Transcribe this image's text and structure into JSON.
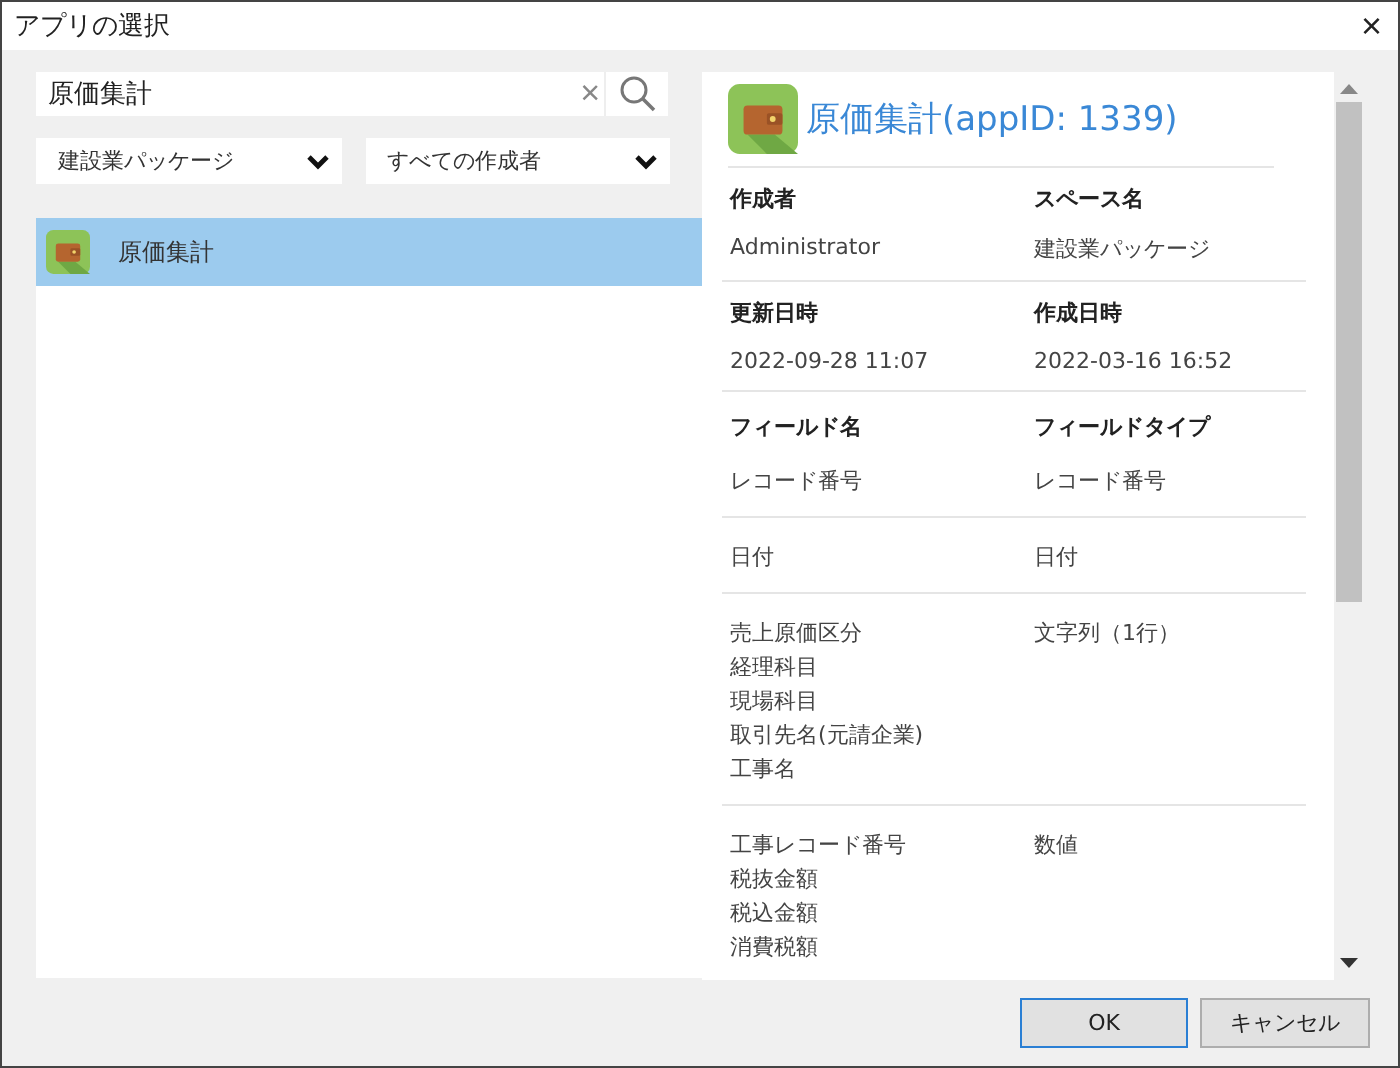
{
  "window": {
    "title": "アプリの選択",
    "close": "×"
  },
  "search": {
    "value": "原価集計",
    "clear": "×"
  },
  "filters": [
    {
      "value": "建設業パッケージ"
    },
    {
      "value": "すべての作成者"
    }
  ],
  "app_list": [
    {
      "name": "原価集計",
      "selected": true
    }
  ],
  "detail": {
    "title": "原価集計(appID: 1339)",
    "meta": [
      [
        {
          "label": "作成者",
          "value": "Administrator"
        },
        {
          "label": "スペース名",
          "value": "建設業パッケージ"
        }
      ],
      [
        {
          "label": "更新日時",
          "value": "2022-09-28 11:07"
        },
        {
          "label": "作成日時",
          "value": "2022-03-16 16:52"
        }
      ]
    ],
    "field_headers": [
      "フィールド名",
      "フィールドタイプ"
    ],
    "field_groups": [
      {
        "names": [
          "レコード番号"
        ],
        "type": "レコード番号"
      },
      {
        "names": [
          "日付"
        ],
        "type": "日付"
      },
      {
        "names": [
          "売上原価区分",
          "経理科目",
          "現場科目",
          "取引先名(元請企業)",
          "工事名"
        ],
        "type": "文字列（1行）"
      },
      {
        "names": [
          "工事レコード番号",
          "税抜金額",
          "税込金額",
          "消費税額"
        ],
        "type": "数値"
      }
    ]
  },
  "buttons": [
    {
      "label": "OK",
      "kind": "primary"
    },
    {
      "label": "キャンセル",
      "kind": "secondary"
    }
  ]
}
